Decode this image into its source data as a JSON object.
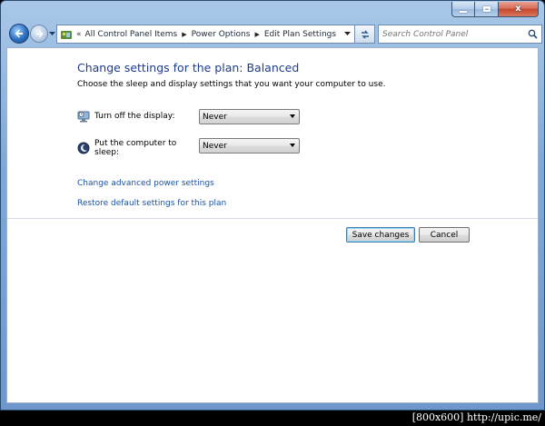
{
  "window": {
    "caption_buttons": {
      "minimize": "",
      "maximize": "",
      "close": "x"
    }
  },
  "nav": {
    "breadcrumb_overflow": "«",
    "breadcrumbs": [
      "All Control Panel Items",
      "Power Options",
      "Edit Plan Settings"
    ],
    "search_placeholder": "Search Control Panel",
    "icons": {
      "back": "back-arrow-icon",
      "forward": "forward-arrow-icon",
      "control_panel": "control-panel-icon",
      "refresh": "refresh-icon",
      "search": "search-icon"
    }
  },
  "main": {
    "heading": "Change settings for the plan: Balanced",
    "description": "Choose the sleep and display settings that you want your computer to use.",
    "settings": [
      {
        "label": "Turn off the display:",
        "value": "Never",
        "icon": "display-icon"
      },
      {
        "label": "Put the computer to sleep:",
        "value": "Never",
        "icon": "sleep-icon"
      }
    ],
    "links": {
      "advanced": "Change advanced power settings",
      "restore": "Restore default settings for this plan"
    },
    "buttons": {
      "save": "Save changes",
      "cancel": "Cancel"
    }
  },
  "watermark": "[800x600] http://upic.me/",
  "colors": {
    "heading": "#1e3c8c",
    "link": "#1a52a6",
    "frame": "#7fa9d8"
  }
}
